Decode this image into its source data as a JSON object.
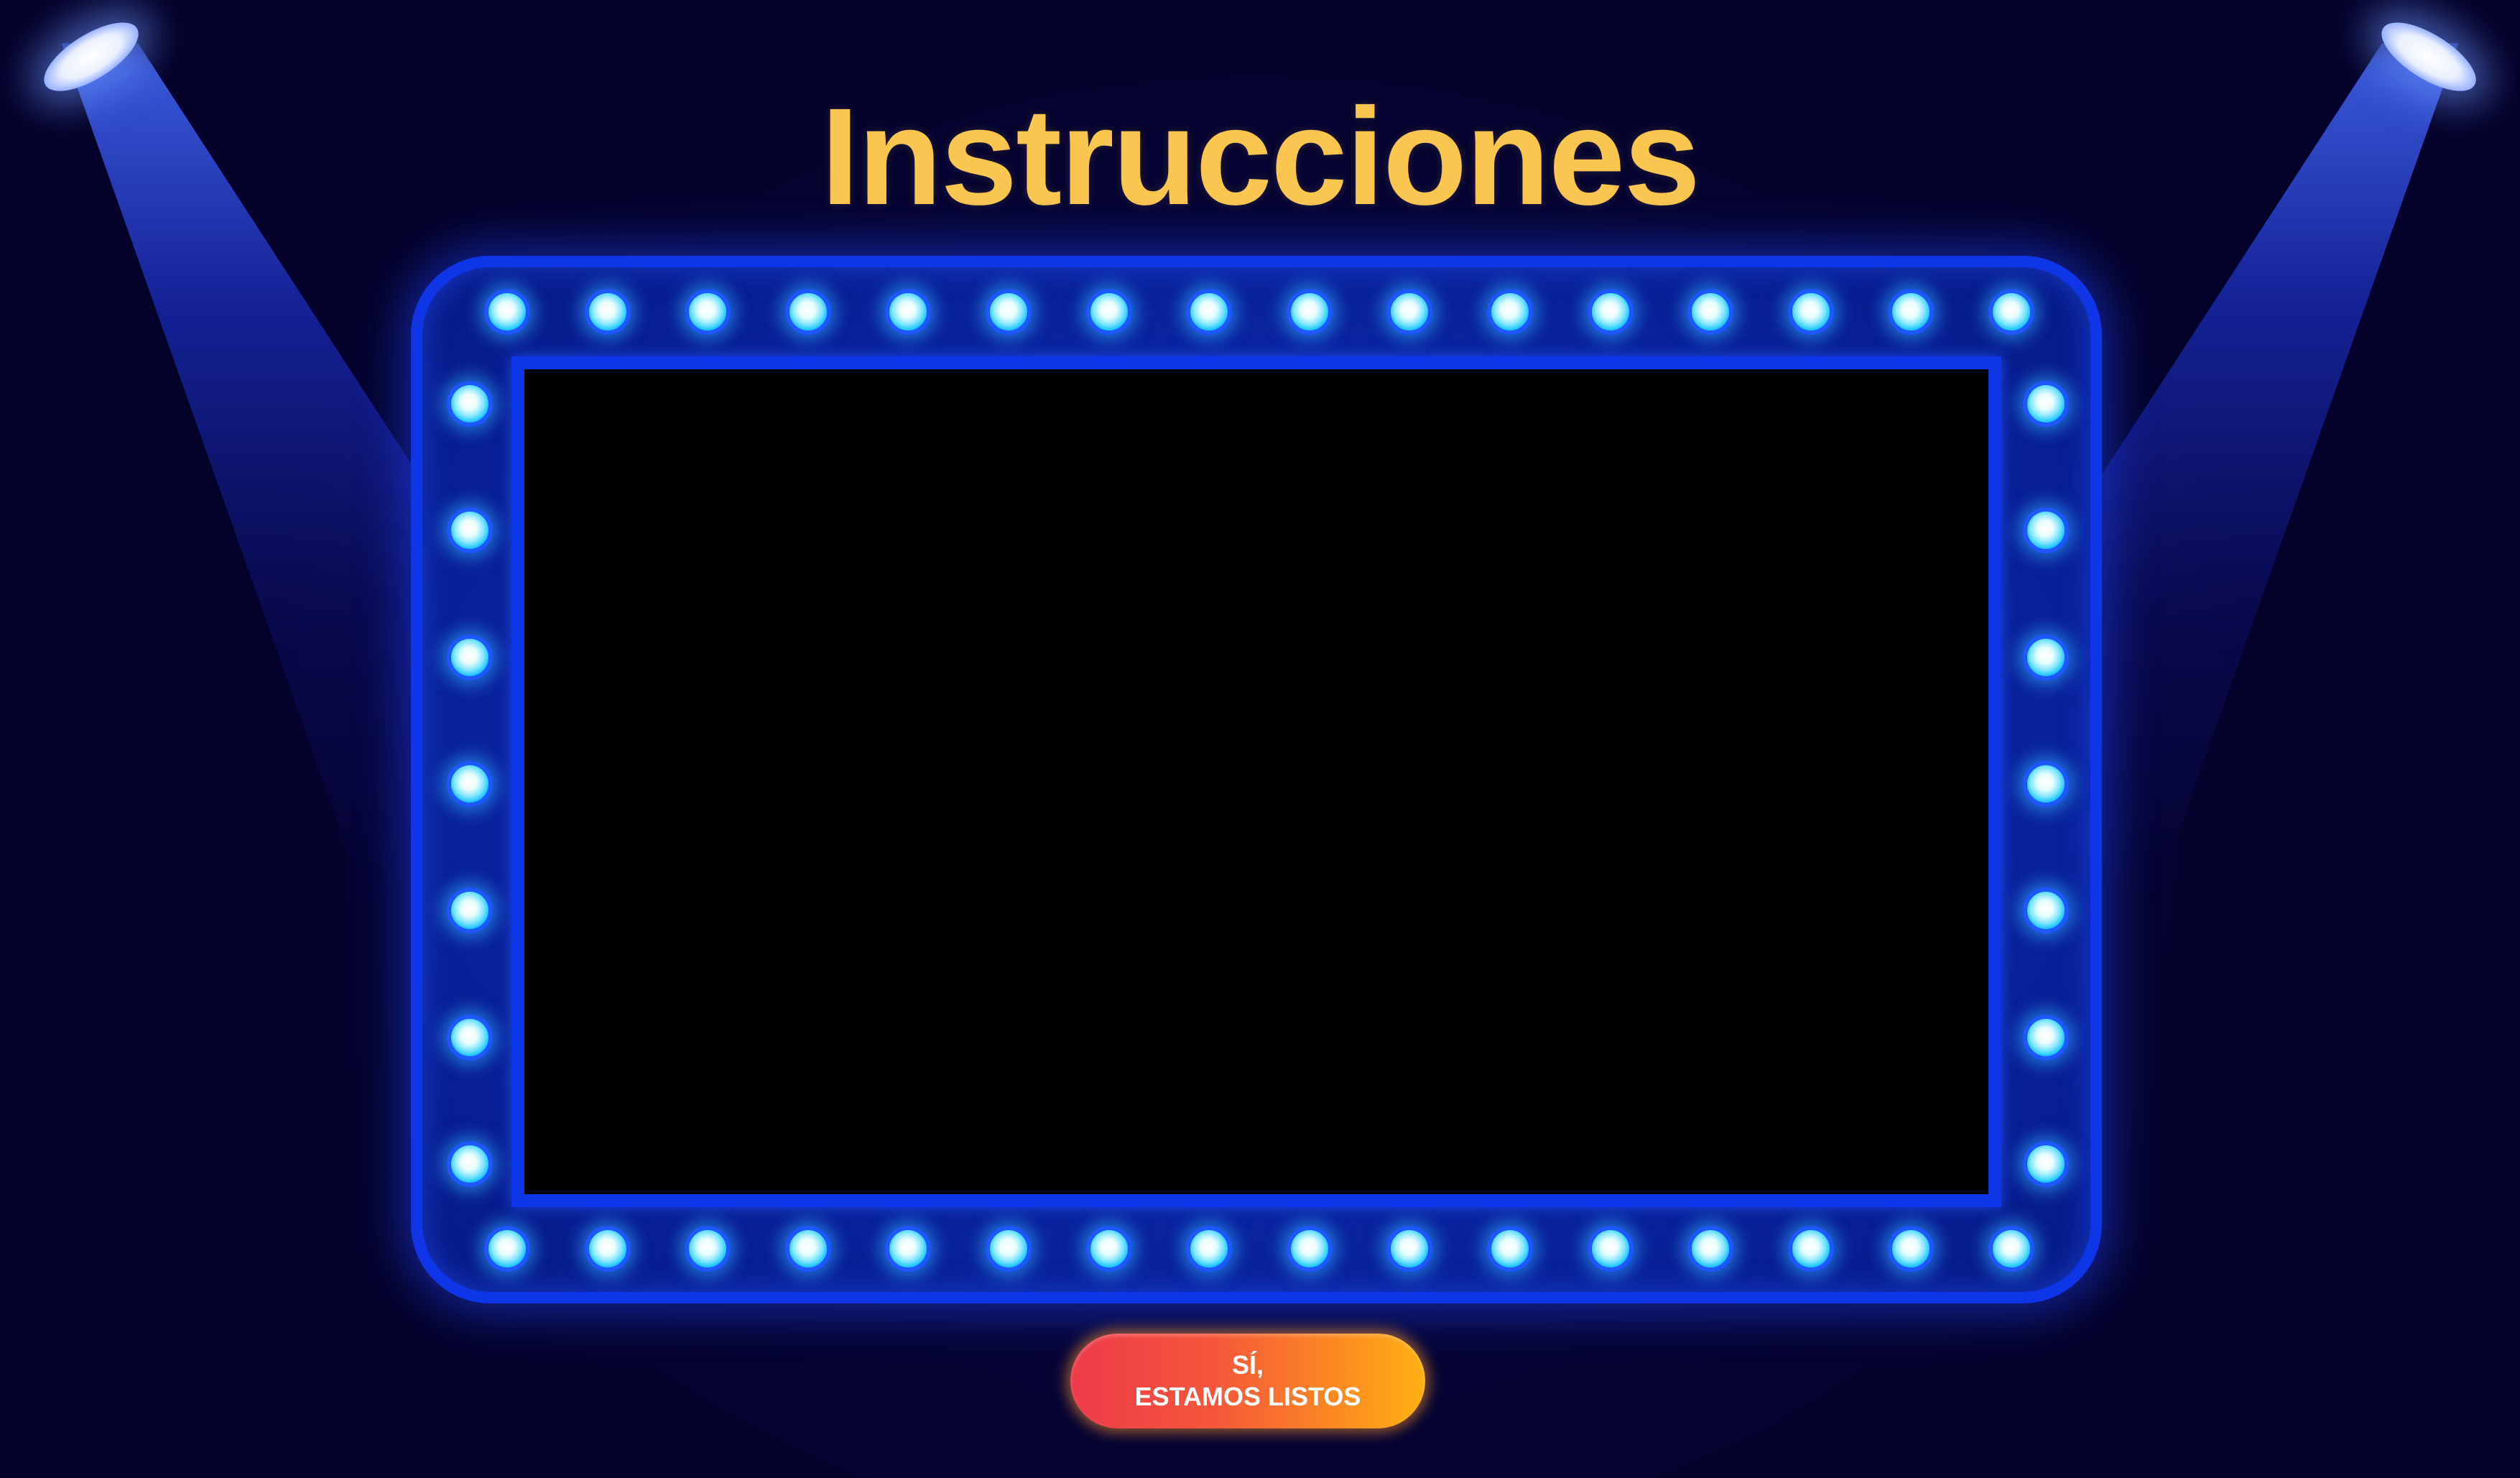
{
  "header": {
    "title": "Instrucciones"
  },
  "marquee": {
    "bulb_count_top": 16,
    "bulb_count_bottom": 16,
    "bulb_count_left": 7,
    "bulb_count_right": 7
  },
  "cta": {
    "line1": "SÍ,",
    "line2": "ESTAMOS LISTOS"
  },
  "colors": {
    "background": "#070538",
    "title": "#fbc650",
    "frame": "#0f36e6",
    "screen": "#000000",
    "bulb_glow": "#7fe6ff",
    "button_start": "#ee3a4a",
    "button_end": "#ffb112"
  },
  "icons": {
    "left_light": "spotlight-icon",
    "right_light": "spotlight-icon",
    "bulb": "bulb-icon"
  }
}
